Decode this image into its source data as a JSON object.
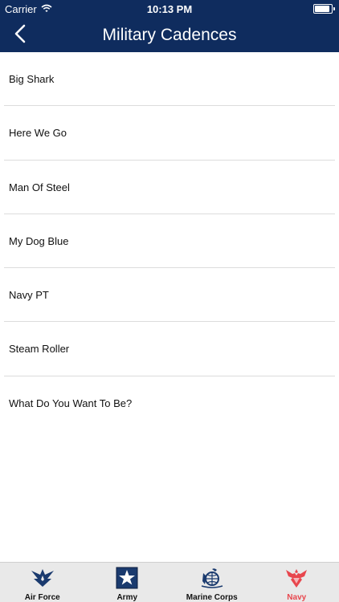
{
  "status": {
    "carrier": "Carrier",
    "time": "10:13 PM",
    "battery_level": 0.9
  },
  "nav": {
    "title": "Military Cadences",
    "back_icon": "chevron-left-icon"
  },
  "items": [
    {
      "label": "Big Shark"
    },
    {
      "label": "Here We Go"
    },
    {
      "label": "Man Of Steel"
    },
    {
      "label": "My Dog Blue"
    },
    {
      "label": "Navy PT"
    },
    {
      "label": "Steam Roller"
    },
    {
      "label": "What Do You Want To Be?"
    }
  ],
  "tabs": [
    {
      "label": "Air Force",
      "icon": "air-force-emblem-icon",
      "active": false
    },
    {
      "label": "Army",
      "icon": "army-star-icon",
      "active": false
    },
    {
      "label": "Marine Corps",
      "icon": "marine-corps-emblem-icon",
      "active": false
    },
    {
      "label": "Navy",
      "icon": "navy-eagle-icon",
      "active": true
    }
  ],
  "colors": {
    "header": "#0f2c5e",
    "active_tab": "#e8464d",
    "tab_icon": "#1a3a6e"
  }
}
